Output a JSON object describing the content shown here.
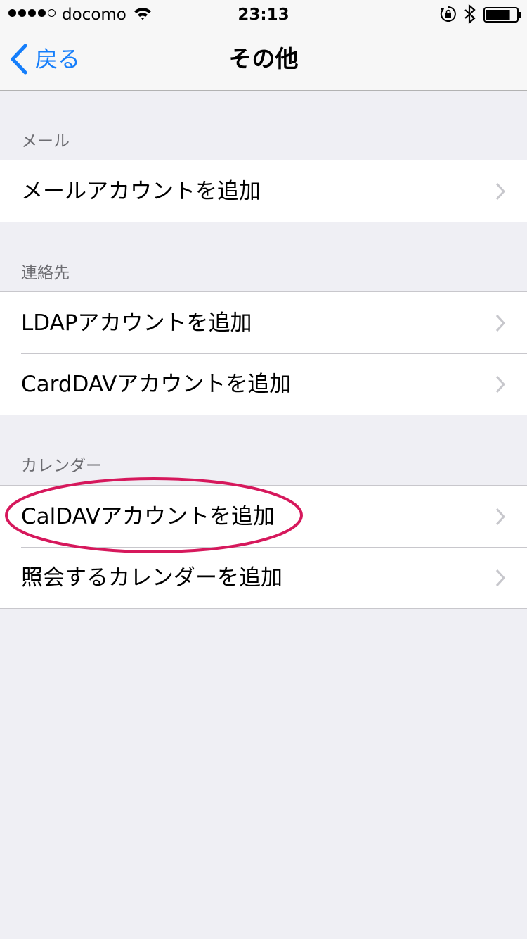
{
  "status_bar": {
    "signal_filled": 4,
    "signal_total": 5,
    "carrier": "docomo",
    "time": "23:13",
    "icons": [
      "wifi-icon",
      "rotation-lock-icon",
      "bluetooth-icon",
      "battery-icon"
    ],
    "battery_level": 0.8
  },
  "nav": {
    "back_label": "戻る",
    "title": "その他",
    "accent_color": "#157efb"
  },
  "sections": [
    {
      "header": "メール",
      "rows": [
        "メールアカウントを追加"
      ]
    },
    {
      "header": "連絡先",
      "rows": [
        "LDAPアカウントを追加",
        "CardDAVアカウントを追加"
      ]
    },
    {
      "header": "カレンダー",
      "rows": [
        "CalDAVアカウントを追加",
        "照会するカレンダーを追加"
      ]
    }
  ],
  "annotation": {
    "highlighted_row": "CalDAVアカウントを追加",
    "color": "#d6185c"
  }
}
